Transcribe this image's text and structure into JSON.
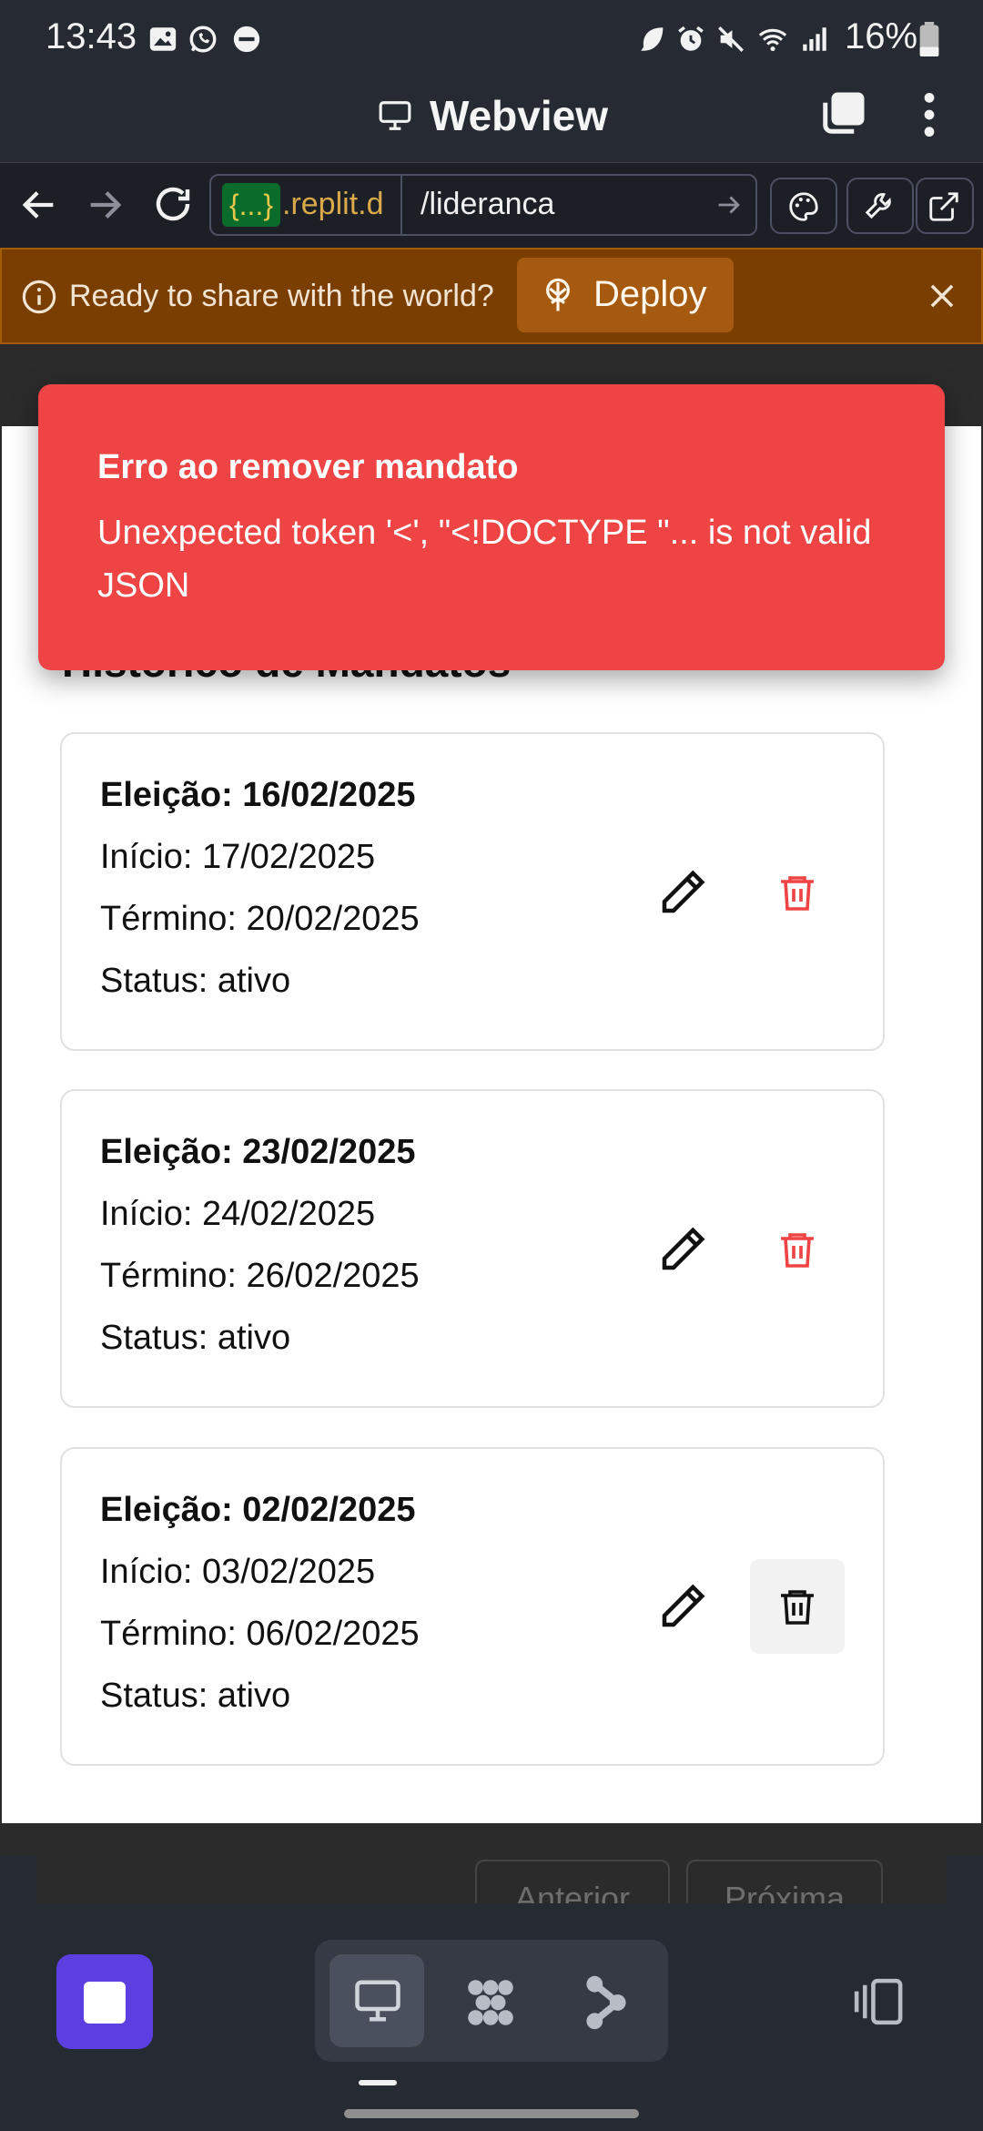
{
  "status_bar": {
    "time": "13:43",
    "battery": "16%",
    "icons": [
      "gallery-icon",
      "whatsapp-icon",
      "dnd-icon",
      "leaf-icon",
      "alarm-icon",
      "mute-icon",
      "wifi-icon",
      "signal-icon",
      "battery-icon"
    ]
  },
  "titlebar": {
    "title": "Webview"
  },
  "urlbar": {
    "badge": "{...}",
    "domain": ".replit.d",
    "path": "/lideranca"
  },
  "deploy_banner": {
    "text": "Ready to share with the world?",
    "button": "Deploy",
    "accent": "#7a3e00"
  },
  "toast": {
    "title": "Erro ao remover mandato",
    "message": "Unexpected token '<', \"<!DOCTYPE \"... is not valid JSON",
    "color": "#ef4444"
  },
  "section": {
    "heading": "Histórico de Mandatos"
  },
  "mandates": [
    {
      "election": "Eleição: 16/02/2025",
      "start": "Início: 17/02/2025",
      "end": "Término: 20/02/2025",
      "status": "Status: ativo"
    },
    {
      "election": "Eleição: 23/02/2025",
      "start": "Início: 24/02/2025",
      "end": "Término: 26/02/2025",
      "status": "Status: ativo"
    },
    {
      "election": "Eleição: 02/02/2025",
      "start": "Início: 03/02/2025",
      "end": "Término: 06/02/2025",
      "status": "Status: ativo"
    }
  ],
  "pagination": {
    "prev": "Anterior",
    "next": "Próxima"
  },
  "bottom_bar": {
    "accent": "#5b3fe0"
  }
}
